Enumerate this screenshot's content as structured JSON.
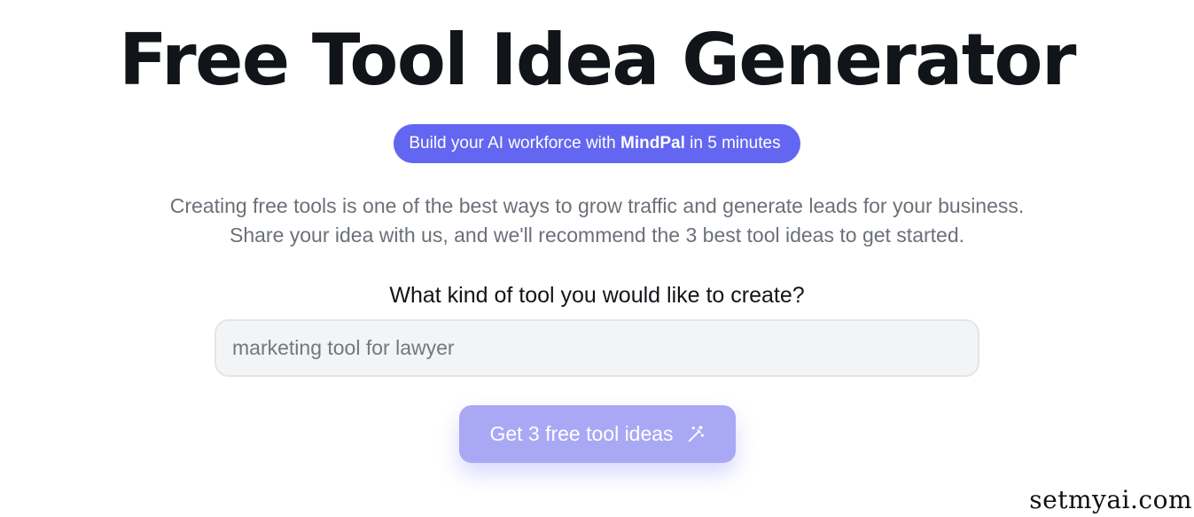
{
  "header": {
    "title": "Free Tool Idea Generator"
  },
  "promo": {
    "prefix": "Build your AI workforce with ",
    "brand": "MindPal",
    "suffix": " in 5 minutes",
    "color": "#6366f1"
  },
  "intro": {
    "line1": "Creating free tools is one of the best ways to grow traffic and generate leads for your business.",
    "line2": "Share your idea with us, and we'll recommend the 3 best tool ideas to get started."
  },
  "form": {
    "question": "What kind of tool you would like to create?",
    "input": {
      "value": "",
      "placeholder": "marketing tool for lawyer"
    },
    "submit": {
      "label": "Get 3 free tool ideas",
      "icon": "magic-wand-icon",
      "color": "#a9a8f5"
    }
  },
  "watermark": {
    "text": "setmyai.com"
  }
}
